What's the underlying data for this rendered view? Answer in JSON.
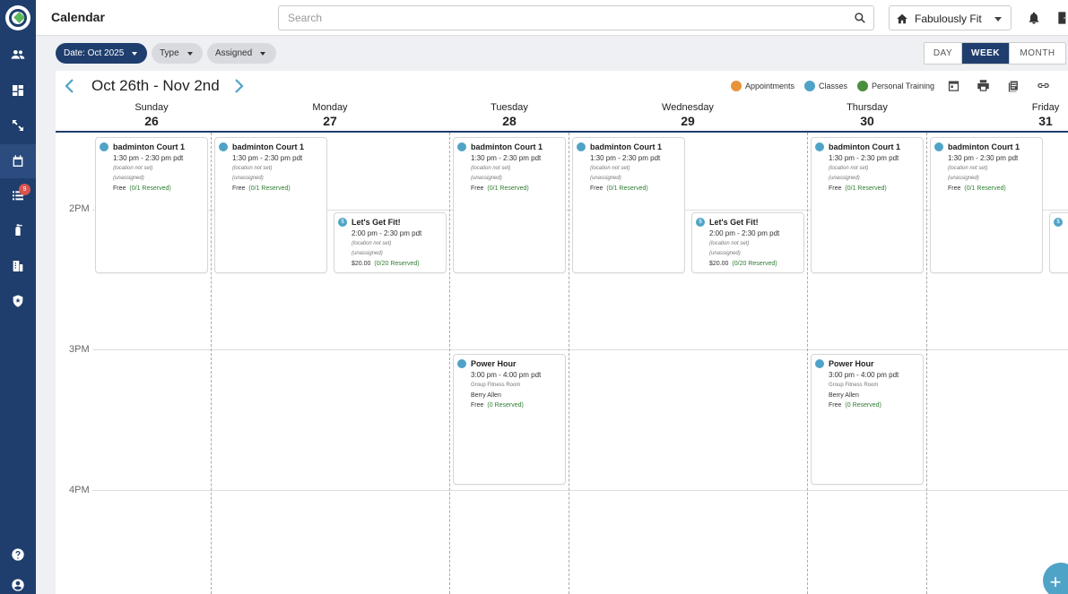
{
  "app": {
    "title": "Calendar"
  },
  "search": {
    "placeholder": "Search",
    "value": ""
  },
  "org": {
    "name": "Fabulously Fit"
  },
  "sidebar": {
    "badge_count": "9",
    "items": [
      {
        "icon": "people-icon"
      },
      {
        "icon": "dashboard-icon"
      },
      {
        "icon": "expand-icon"
      },
      {
        "icon": "calendar-icon"
      },
      {
        "icon": "list-icon"
      },
      {
        "icon": "fire-extinguisher-icon"
      },
      {
        "icon": "building-icon"
      },
      {
        "icon": "shield-star-icon"
      },
      {
        "icon": "help-icon"
      },
      {
        "icon": "account-icon"
      }
    ]
  },
  "filters": {
    "date": "Date: Oct 2025",
    "type": "Type",
    "assigned": "Assigned"
  },
  "views": {
    "day": "DAY",
    "week": "WEEK",
    "month": "MONTH",
    "active": "WEEK"
  },
  "calendar": {
    "range": "Oct 26th - Nov 2nd",
    "legend": [
      {
        "label": "Appointments",
        "color": "#e8933a"
      },
      {
        "label": "Classes",
        "color": "#4fa3c7"
      },
      {
        "label": "Personal Training",
        "color": "#4a8f3c"
      }
    ],
    "days": [
      {
        "name": "Sunday",
        "num": "26"
      },
      {
        "name": "Monday",
        "num": "27"
      },
      {
        "name": "Tuesday",
        "num": "28"
      },
      {
        "name": "Wednesday",
        "num": "29"
      },
      {
        "name": "Thursday",
        "num": "30"
      },
      {
        "name": "Friday",
        "num": "31"
      }
    ],
    "times": [
      "2PM",
      "3PM",
      "4PM"
    ],
    "events": {
      "badminton": {
        "title": "badminton Court 1",
        "time": "1:30 pm - 2:30 pm pdt",
        "location": "(location not set)",
        "assigned": "(unassigned)",
        "price": "Free",
        "reserved": "(0/1 Reserved)"
      },
      "getfit": {
        "title": "Let's Get Fit!",
        "time": "2:00 pm - 2:30 pm pdt",
        "location": "(location not set)",
        "assigned": "(unassigned)",
        "price": "$20.00",
        "reserved": "(0/20 Reserved)",
        "icon": "$"
      },
      "powerhour": {
        "title": "Power Hour",
        "time": "3:00 pm - 4:00 pm pdt",
        "location": "Group Fitness Room",
        "assigned": "Berry Allen",
        "price": "Free",
        "reserved": "(0 Reserved)"
      }
    }
  },
  "fab": {
    "label": "+"
  }
}
